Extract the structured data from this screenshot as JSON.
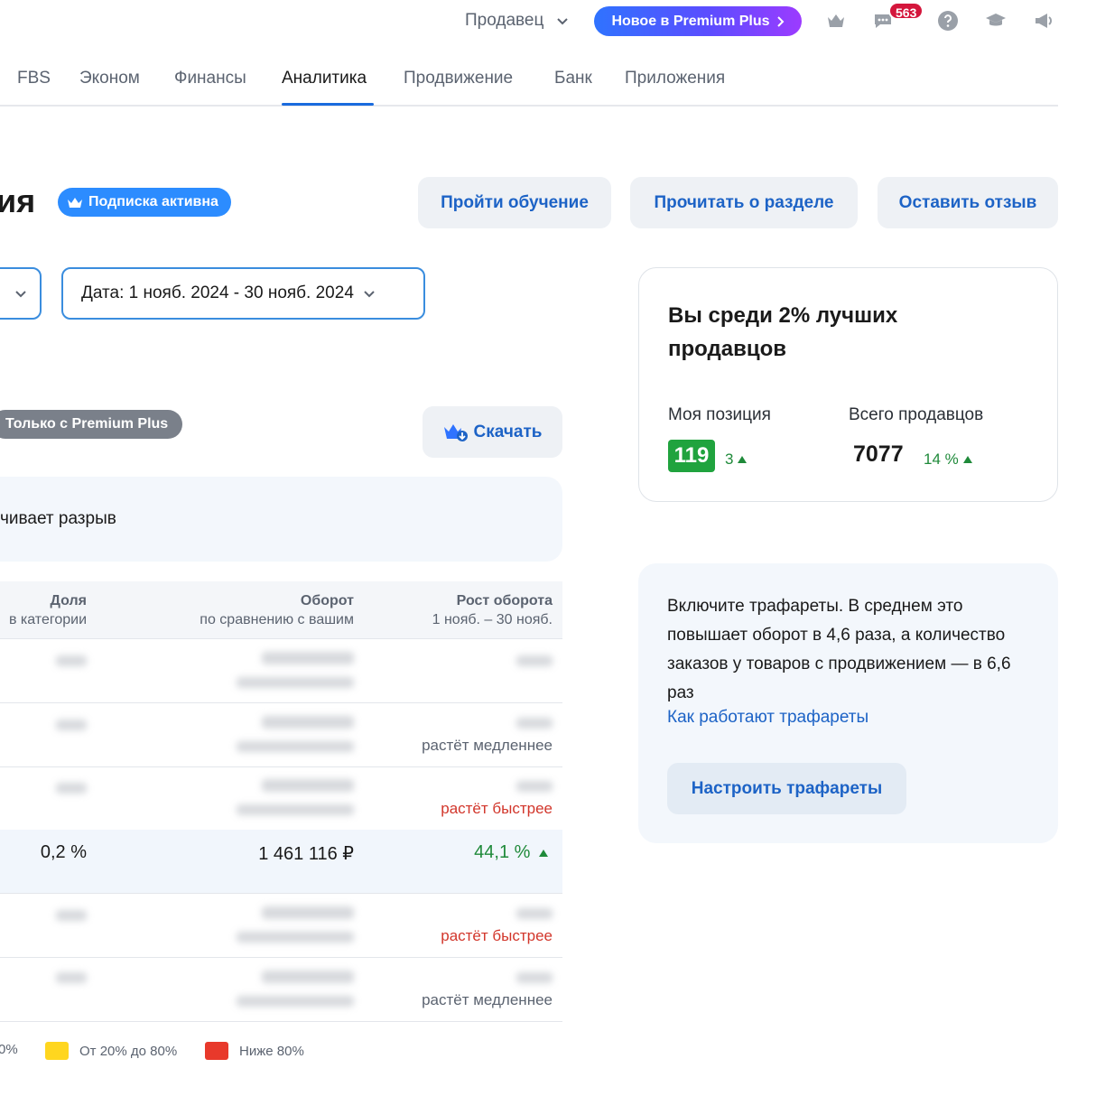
{
  "topbar": {
    "seller_label": "Продавец",
    "premium_label": "Новое в Premium Plus",
    "messages_count": "563",
    "icons": [
      "crown-icon",
      "chat-icon",
      "help-icon",
      "education-icon",
      "megaphone-icon"
    ]
  },
  "nav": {
    "items": [
      "FBS",
      "Эконом",
      "Финансы",
      "Аналитика",
      "Продвижение",
      "Банк",
      "Приложения"
    ],
    "active": "Аналитика"
  },
  "header": {
    "title_fragment": "ия",
    "subscription_badge": "Подписка активна",
    "btn_training": "Пройти обучение",
    "btn_read": "Прочитать о разделе",
    "btn_feedback": "Оставить отзыв"
  },
  "filters": {
    "date_label": "Дата: 1 нояб. 2024 - 30 нояб. 2024"
  },
  "section": {
    "only_premium_tag": "Только с Premium Plus",
    "download_label": "Скачать",
    "info_text": "чивает разрыв"
  },
  "table": {
    "headers": {
      "share_title": "Доля",
      "share_sub": "в категории",
      "turnover_title": "Оборот",
      "turnover_sub": "по сравнению с вашим",
      "growth_title": "Рост оборота",
      "growth_sub": "1 нояб. – 30 нояб."
    },
    "rows": [
      {
        "note": ""
      },
      {
        "note": "растёт медленнее"
      },
      {
        "note": "растёт быстрее"
      },
      {
        "share": "0,2 %",
        "turnover": "1 461 116 ₽",
        "growth": "44,1 %"
      },
      {
        "note": "растёт быстрее"
      },
      {
        "note": "растёт медленнее"
      }
    ]
  },
  "legend": {
    "item1": "0%",
    "item2": "От 20% до 80%",
    "item3": "Ниже 80%",
    "colors": {
      "gray": "#c9ccd1",
      "yellow": "#ffd61f",
      "red": "#e8392b"
    }
  },
  "rank_card": {
    "title": "Вы среди 2% лучших продавцов",
    "my_position_label": "Моя позиция",
    "my_position": "119",
    "my_position_delta": "3",
    "total_label": "Всего продавцов",
    "total": "7077",
    "total_delta": "14 %"
  },
  "templates_card": {
    "text": "Включите трафареты. В среднем это повышает оборот в 4,6 раза, а количество заказов у товаров с продвижением — в 6,6 раз",
    "link": "Как работают трафареты",
    "button": "Настроить трафареты"
  },
  "colors": {
    "accent": "#1d63c6",
    "positive": "#1f8a3a",
    "negative": "#d2362b"
  }
}
